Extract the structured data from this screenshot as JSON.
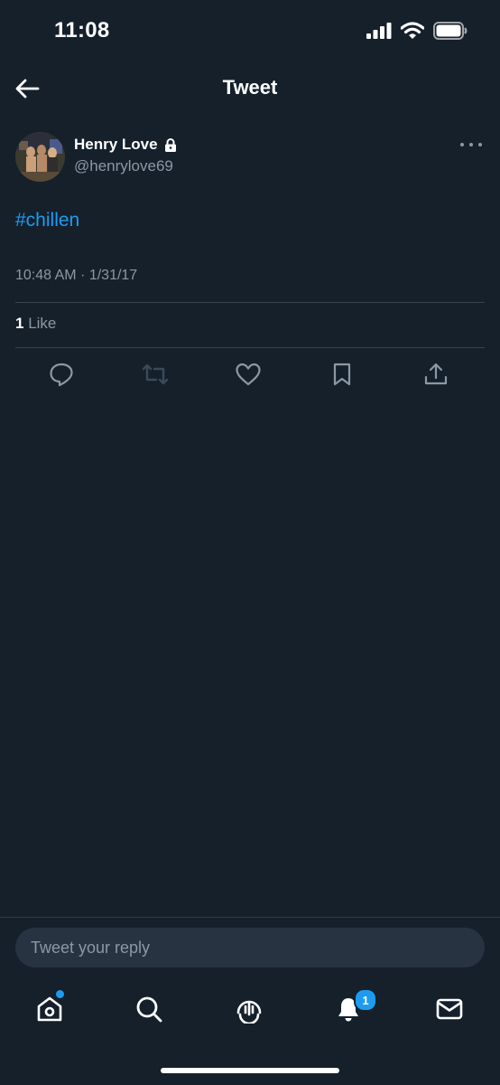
{
  "status_bar": {
    "time": "11:08"
  },
  "header": {
    "title": "Tweet"
  },
  "tweet": {
    "author_name": "Henry Love",
    "author_handle": "@henrylove69",
    "text": "#chillen",
    "timestamp": "10:48 AM · 1/31/17",
    "like_count": "1",
    "like_label": " Like"
  },
  "actions": [
    "reply-icon",
    "retweet-icon",
    "like-icon",
    "bookmark-icon",
    "share-icon"
  ],
  "composer": {
    "placeholder": "Tweet your reply"
  },
  "tab_bar": {
    "items": [
      "home-icon",
      "search-icon",
      "spaces-icon",
      "notifications-icon",
      "messages-icon"
    ],
    "notification_badge": "1"
  },
  "colors": {
    "background": "#15202b",
    "accent": "#1d9bf0",
    "secondary_text": "#8b98a5",
    "divider": "#38444d"
  }
}
